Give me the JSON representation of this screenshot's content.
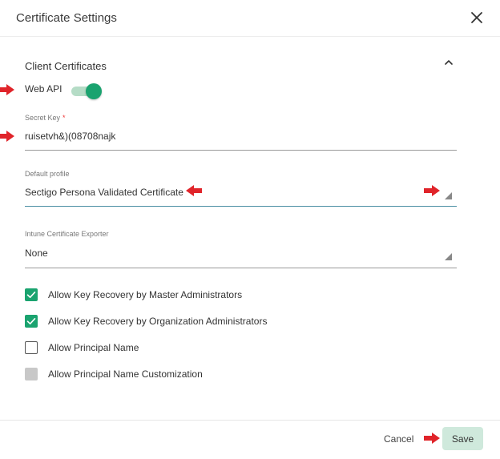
{
  "dialog": {
    "title": "Certificate Settings"
  },
  "section": {
    "title": "Client Certificates"
  },
  "web_api": {
    "label": "Web API",
    "enabled": true
  },
  "secret_key": {
    "label": "Secret Key",
    "required_mark": "*",
    "value": "ruisetvh&)(08708najk"
  },
  "default_profile": {
    "label": "Default profile",
    "value": "Sectigo Persona Validated Certificate"
  },
  "intune_exporter": {
    "label": "Intune Certificate Exporter",
    "value": "None"
  },
  "checkboxes": [
    {
      "label": "Allow Key Recovery by Master Administrators",
      "state": "checked"
    },
    {
      "label": "Allow Key Recovery by Organization Administrators",
      "state": "checked"
    },
    {
      "label": "Allow Principal Name",
      "state": "unchecked"
    },
    {
      "label": "Allow Principal Name Customization",
      "state": "disabled"
    }
  ],
  "footer": {
    "cancel_label": "Cancel",
    "save_label": "Save"
  },
  "colors": {
    "accent": "#1aa36f",
    "annotation_arrow": "#e0242a",
    "save_bg": "#cfe9dc"
  }
}
